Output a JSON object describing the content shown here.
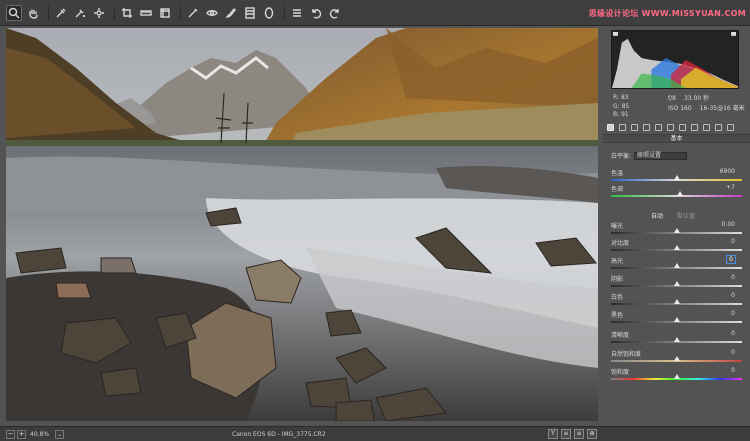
{
  "toolbar": {
    "watermark": "思缘设计论坛 WWW.MISSYUAN.COM",
    "tools": [
      "zoom-icon",
      "hand-icon",
      "white-balance-icon",
      "color-sampler-icon",
      "targeted-adjust-icon",
      "crop-icon",
      "straighten-icon",
      "transform-icon",
      "spot-removal-icon",
      "red-eye-icon",
      "adjustment-brush-icon",
      "graduated-filter-icon",
      "radial-filter-icon",
      "preferences-icon",
      "rotate-ccw-icon",
      "rotate-cw-icon"
    ]
  },
  "status": {
    "zoom_out": "−",
    "zoom_in": "+",
    "zoom": "40.8%",
    "dropdown": "⌄",
    "file": "Canon EOS 6D  -  IMG_3775.CR2",
    "y_btn": "Y",
    "btn2": "≡",
    "btn3": "≡",
    "btn4": "⊕"
  },
  "panel": {
    "rgb": {
      "r_label": "R:",
      "r": "83",
      "g_label": "G:",
      "g": "85",
      "b_label": "B:",
      "b": "91"
    },
    "exif": {
      "aperture": "f/8",
      "shutter": "33.00 秒",
      "iso": "ISO 160",
      "lens": "16-35@16 毫米"
    },
    "section_title": "基本",
    "wb_label": "白平衡:",
    "wb_value": "原照设置",
    "auto_label": "自动",
    "default_label": "默认值",
    "sliders": [
      {
        "label": "色温",
        "value": "6900",
        "pos": 0.5
      },
      {
        "label": "色调",
        "value": "+7",
        "pos": 0.53
      },
      {
        "label": "曝光",
        "value": "0.00",
        "pos": 0.5
      },
      {
        "label": "对比度",
        "value": "0",
        "pos": 0.5
      },
      {
        "label": "高光",
        "value": "0",
        "pos": 0.5
      },
      {
        "label": "阴影",
        "value": "0",
        "pos": 0.5
      },
      {
        "label": "白色",
        "value": "0",
        "pos": 0.5
      },
      {
        "label": "黑色",
        "value": "0",
        "pos": 0.5
      },
      {
        "label": "清晰度",
        "value": "0",
        "pos": 0.5
      },
      {
        "label": "自然饱和度",
        "value": "0",
        "pos": 0.5
      },
      {
        "label": "饱和度",
        "value": "0",
        "pos": 0.5
      }
    ]
  },
  "colors": {
    "bg": "#535353",
    "toolbar": "#3f3f3f",
    "histo_bg": "#232323",
    "accent": "#4a8fe0"
  }
}
